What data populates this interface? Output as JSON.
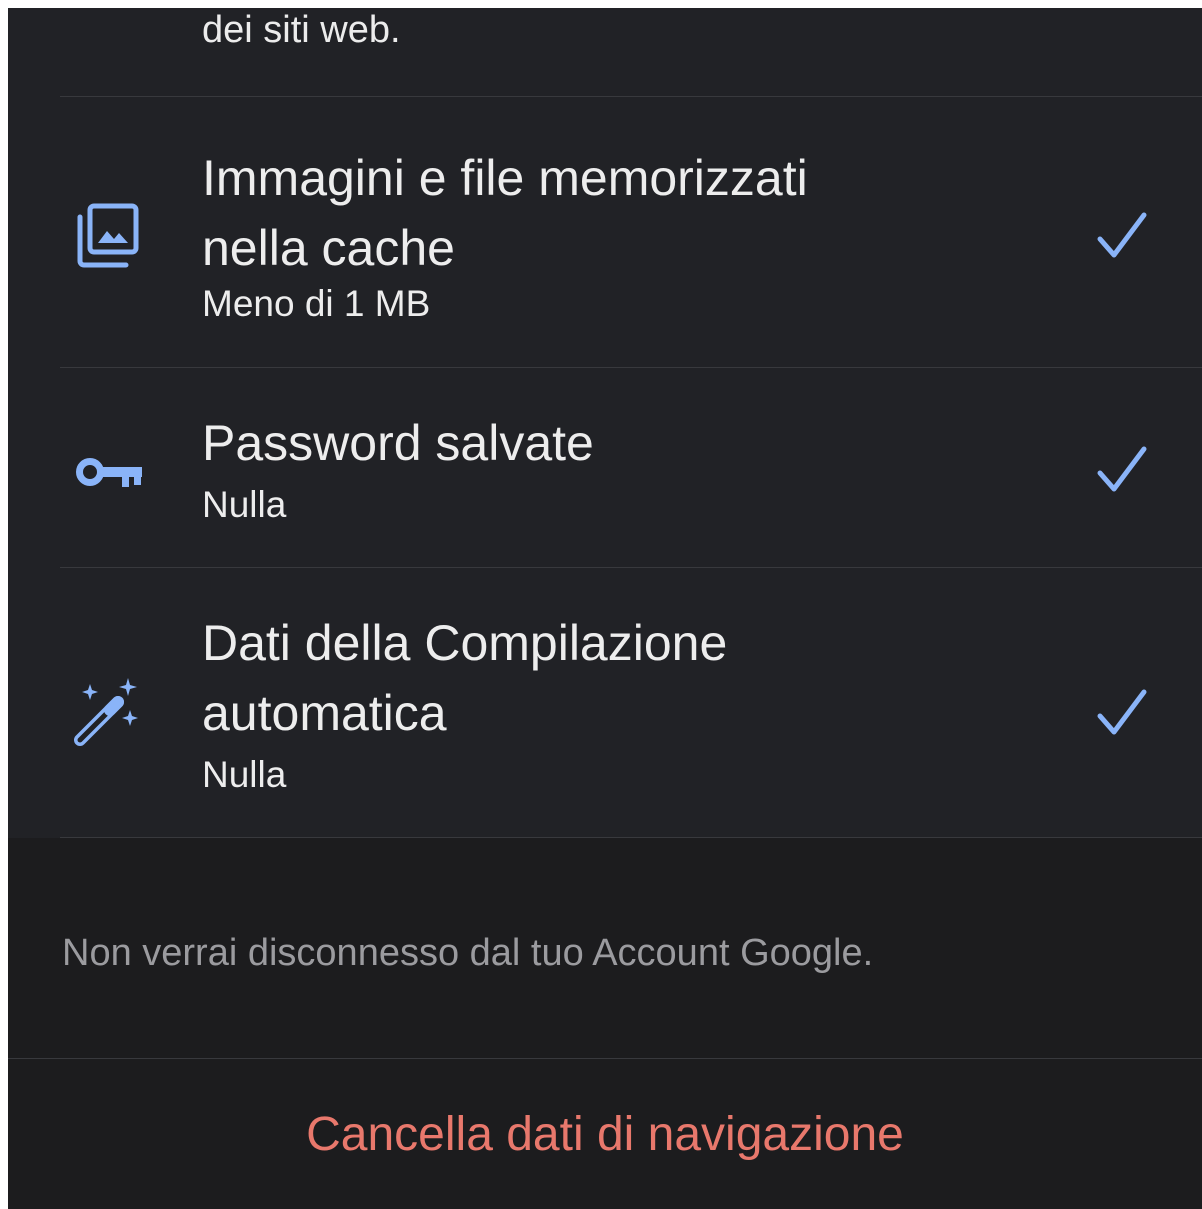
{
  "top_text": "dei siti web.",
  "items": [
    {
      "title_line1": "Immagini e file memorizzati",
      "title_line2": "nella cache",
      "subtitle": "Meno di 1 MB",
      "icon": "cached-images-icon",
      "checked": true
    },
    {
      "title_line1": "Password salvate",
      "subtitle": "Nulla",
      "icon": "key-icon",
      "checked": true
    },
    {
      "title_line1": "Dati della Compilazione",
      "title_line2": "automatica",
      "subtitle": "Nulla",
      "icon": "magic-wand-icon",
      "checked": true
    }
  ],
  "footer_note": "Non verrai disconnesso dal tuo Account Google.",
  "clear_button_label": "Cancella dati di navigazione",
  "colors": {
    "accent_blue": "#8ab4f8",
    "destructive_red": "#e8786c",
    "list_background": "#212226",
    "page_background": "#1c1c1e"
  }
}
